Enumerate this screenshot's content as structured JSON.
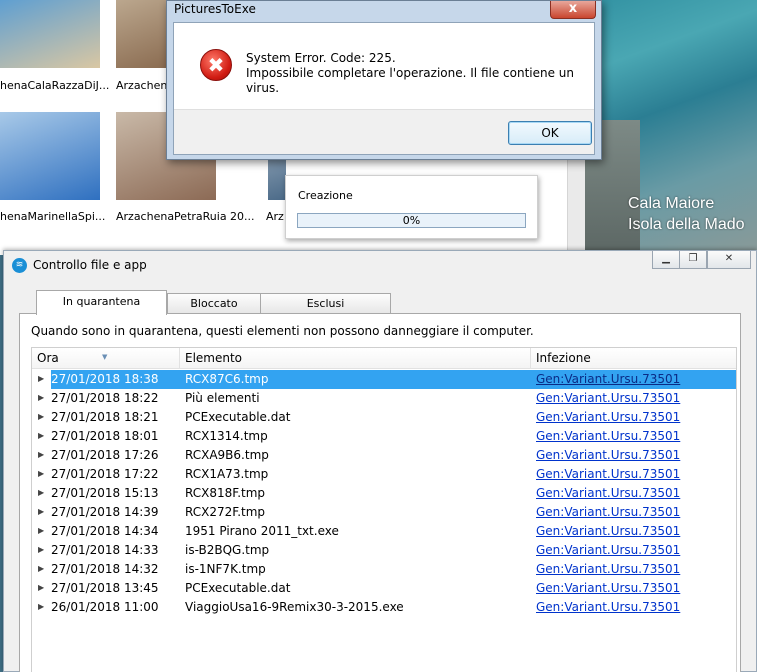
{
  "background": {
    "caption_line1": "Cala Maiore",
    "caption_line2": "Isola della Mado",
    "thumbnails": [
      {
        "label": "henaCalaRazzaDiJ...",
        "colors": [
          "#d9c7a3",
          "#5f9fd1"
        ]
      },
      {
        "label": "Arzachen",
        "colors": [
          "#8a6b50",
          "#bba78e"
        ]
      },
      {
        "label": "henaMarinellaSpi...",
        "colors": [
          "#2f70c0",
          "#a8c9e8"
        ]
      },
      {
        "label": "ArzachenaPetraRuia 20...",
        "colors": [
          "#8c6a55",
          "#c9b9a8"
        ]
      },
      {
        "label": "Arz",
        "colors": [
          "#4b6a88",
          "#7d94aa"
        ]
      }
    ]
  },
  "error_dialog": {
    "title": "PicturesToExe",
    "close_label": "x",
    "icon": "error-x-icon",
    "icon_glyph": "✖",
    "message_line1": "System Error.  Code: 225.",
    "message_line2": "Impossibile completare l'operazione. Il file contiene un virus.",
    "ok_label": "OK"
  },
  "progress_popup": {
    "label": "Creazione",
    "percent_text": "0%",
    "progress": 0.0
  },
  "main_window": {
    "title": "Controllo file e app",
    "app_icon": "wifi-shield-icon",
    "buttons": {
      "minimize": "▁",
      "restore": "❐",
      "close": "✕"
    },
    "tabs": [
      {
        "label": "In quarantena",
        "active": true
      },
      {
        "label": "Bloccato",
        "active": false
      },
      {
        "label": "Esclusi",
        "active": false
      }
    ],
    "description": "Quando sono in quarantena, questi elementi non possono danneggiare il computer.",
    "columns": {
      "date": "Ora",
      "item": "Elemento",
      "infection": "Infezione"
    },
    "rows": [
      {
        "date": "27/01/2018 18:38",
        "item": "RCX87C6.tmp",
        "infection": "Gen:Variant.Ursu.73501",
        "selected": true
      },
      {
        "date": "27/01/2018 18:22",
        "item": "Più elementi",
        "infection": "Gen:Variant.Ursu.73501"
      },
      {
        "date": "27/01/2018 18:21",
        "item": "PCExecutable.dat",
        "infection": "Gen:Variant.Ursu.73501"
      },
      {
        "date": "27/01/2018 18:01",
        "item": "RCX1314.tmp",
        "infection": "Gen:Variant.Ursu.73501"
      },
      {
        "date": "27/01/2018 17:26",
        "item": "RCXA9B6.tmp",
        "infection": "Gen:Variant.Ursu.73501"
      },
      {
        "date": "27/01/2018 17:22",
        "item": "RCX1A73.tmp",
        "infection": "Gen:Variant.Ursu.73501"
      },
      {
        "date": "27/01/2018 15:13",
        "item": "RCX818F.tmp",
        "infection": "Gen:Variant.Ursu.73501"
      },
      {
        "date": "27/01/2018 14:39",
        "item": "RCX272F.tmp",
        "infection": "Gen:Variant.Ursu.73501"
      },
      {
        "date": "27/01/2018 14:34",
        "item": "1951 Pirano 2011_txt.exe",
        "infection": "Gen:Variant.Ursu.73501"
      },
      {
        "date": "27/01/2018 14:33",
        "item": "is-B2BQG.tmp",
        "infection": "Gen:Variant.Ursu.73501"
      },
      {
        "date": "27/01/2018 14:32",
        "item": "is-1NF7K.tmp",
        "infection": "Gen:Variant.Ursu.73501"
      },
      {
        "date": "27/01/2018 13:45",
        "item": "PCExecutable.dat",
        "infection": "Gen:Variant.Ursu.73501"
      },
      {
        "date": "26/01/2018 11:00",
        "item": "ViaggioUsa16-9Remix30-3-2015.exe",
        "infection": "Gen:Variant.Ursu.73501"
      }
    ]
  }
}
